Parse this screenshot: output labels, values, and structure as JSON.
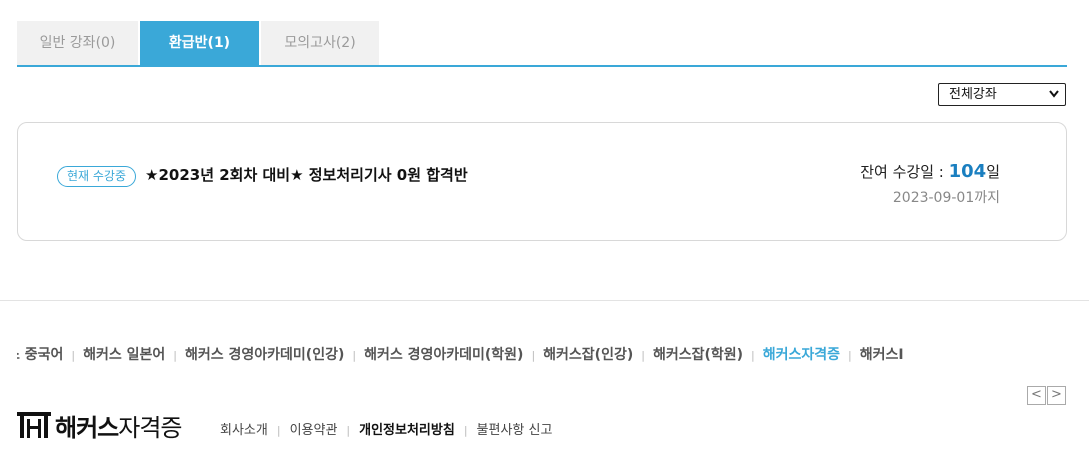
{
  "tabs": [
    {
      "label": "일반 강좌(0)"
    },
    {
      "label": "환급반(1)"
    },
    {
      "label": "모의고사(2)"
    }
  ],
  "filter": {
    "selected": "전체강좌"
  },
  "course": {
    "badge": "현재 수강중",
    "title": "★2023년 2회차 대비★ 정보처리기사 0원 합격반",
    "remain_label": "잔여 수강일 : ",
    "remain_days": "104",
    "remain_unit": "일",
    "until": "2023-09-01까지"
  },
  "family_sites": [
    {
      "label": "스 중국어"
    },
    {
      "label": "해커스 일본어"
    },
    {
      "label": "해커스 경영아카데미(인강)"
    },
    {
      "label": "해커스 경영아카데미(학원)"
    },
    {
      "label": "해커스잡(인강)"
    },
    {
      "label": "해커스잡(학원)"
    },
    {
      "label": "해커스자격증"
    },
    {
      "label": "해커스I"
    }
  ],
  "pager": {
    "prev": "<",
    "next": ">"
  },
  "logo": {
    "part1": "해커스",
    "part2": "자격증"
  },
  "footer_links": [
    {
      "label": "회사소개"
    },
    {
      "label": "이용약관"
    },
    {
      "label": "개인정보처리방침"
    },
    {
      "label": "불편사항 신고"
    }
  ],
  "colors": {
    "accent": "#3aa8d8",
    "remain_number": "#1a7fc0"
  }
}
